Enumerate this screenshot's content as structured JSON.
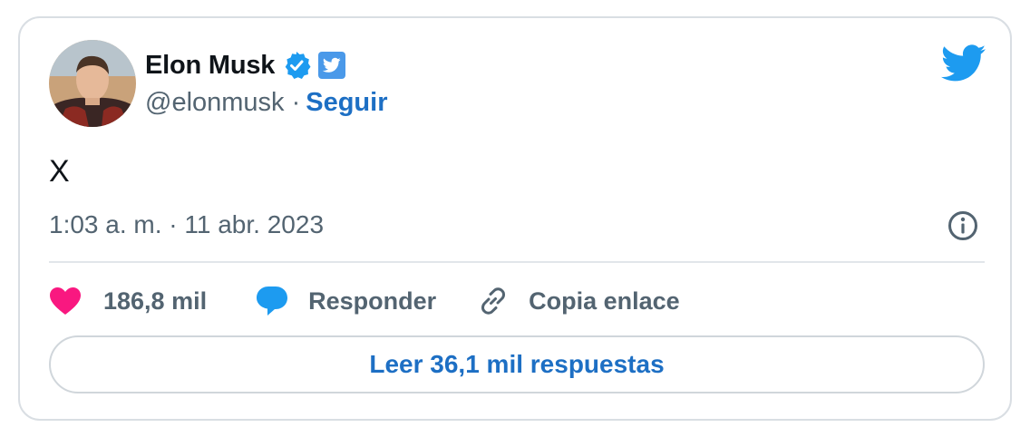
{
  "author": {
    "name": "Elon Musk",
    "handle": "@elonmusk",
    "separator": "·",
    "follow_label": "Seguir"
  },
  "tweet": {
    "text": "X",
    "timestamp": "1:03 a. m. · 11 abr. 2023"
  },
  "actions": {
    "likes_count": "186,8 mil",
    "reply_label": "Responder",
    "copy_link_label": "Copia enlace"
  },
  "read_replies_label": "Leer 36,1 mil respuestas",
  "icons": {
    "verified": "verified-badge-icon",
    "twitter_badge": "twitter-bird-badge-icon",
    "brand": "twitter-bird-icon",
    "info": "info-icon",
    "like": "heart-icon",
    "reply": "speech-bubble-icon",
    "copy": "link-icon"
  },
  "colors": {
    "accent": "#1d9bf0",
    "link": "#1d6fc4",
    "heart": "#f91880",
    "secondary_text": "#536471",
    "primary_text": "#0f1419"
  }
}
